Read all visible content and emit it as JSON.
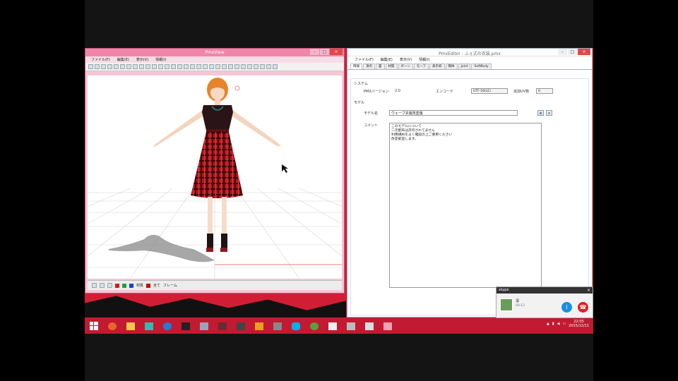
{
  "pmxview": {
    "title": "PmxView",
    "menu": [
      "ファイル(F)",
      "編集(E)",
      "表示(V)",
      "情報(I)"
    ],
    "status_label": "材質",
    "status_combo": "全て",
    "status_extra": "フレーム"
  },
  "pmxeditor": {
    "title": "PmxEditor - ふぇ式の衣装.pmx",
    "menu": [
      "ファイル(F)",
      "編集(E)",
      "表示(V)",
      "情報(I)"
    ],
    "tabs": [
      "情報",
      "頂点",
      "面",
      "材質",
      "ボーン",
      "モーフ",
      "表示枠",
      "剛体",
      "Joint",
      "SoftBody"
    ],
    "section_system": "システム",
    "pmx_version_label": "PMXバージョン",
    "pmx_version_value": "2.0",
    "encoding_label": "エンコード",
    "encoding_value": "UTF-16(LE)",
    "uv_label": "追加UV数",
    "uv_value": "0",
    "section_model": "モデル",
    "model_name_label": "モデル名",
    "model_name_value": "ウェーブ衣装改変版",
    "comment_label": "コメント",
    "comment_lines": [
      "このモデルについて",
      "二次配布は許可されてません",
      "利用規約をよく確認の上ご使用ください",
      "改変歓迎します。"
    ]
  },
  "skype": {
    "brand": "skype",
    "caller_name": "凛",
    "call_time": "00:12"
  },
  "taskbar": {
    "time": "22:05",
    "date": "2015/12/11"
  },
  "colors": {
    "accent": "#ef86a9",
    "desktop": "#d21e34",
    "taskbar": "#c21a30"
  }
}
